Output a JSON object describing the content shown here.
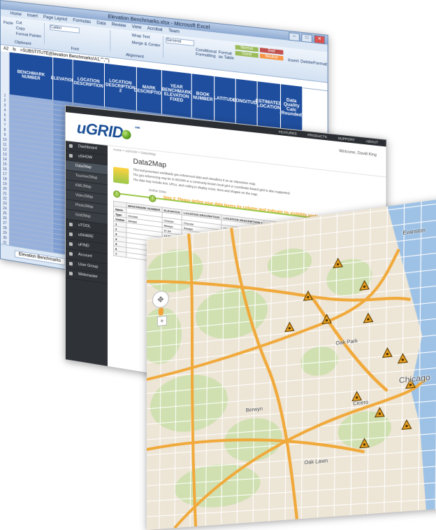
{
  "excel": {
    "window_title": "Elevation Benchmarks.xlsx - Microsoft Excel",
    "ribbon_tabs": [
      "Home",
      "Insert",
      "Page Layout",
      "Formulas",
      "Data",
      "Review",
      "View",
      "Acrobat",
      "Team"
    ],
    "ribbon_buttons": {
      "cut": "Cut",
      "copy": "Copy",
      "paste": "Paste",
      "format_painter": "Format Painter",
      "wrap_text": "Wrap Text",
      "merge_center": "Merge & Center",
      "number_format": "General",
      "conditional": "Conditional Formatting",
      "format_table": "Format as Table",
      "insert": "Insert",
      "delete": "Delete",
      "format": "Format",
      "clipboard": "Clipboard",
      "font_group": "Font",
      "alignment": "Alignment"
    },
    "font_name": "Calibri",
    "cell_ref": "A2",
    "formula": "=SUBSTITUTE(Elevation Benchmarks!A1,\"\",\"\")",
    "style_chips": [
      {
        "label": "Normal",
        "color": "#9bbb59"
      },
      {
        "label": "Bad",
        "color": "#c0504d"
      },
      {
        "label": "Good",
        "color": "#9bbb59"
      },
      {
        "label": "Neutral",
        "color": "#f79646"
      }
    ],
    "columns": [
      "BENCHMARK NUMBER",
      "ELEVATION",
      "LOCATION DESCRIPTION",
      "LOCATION DESCRIPTION 2",
      "MARK DESCRIPTION",
      "YEAR BENCHMARK ELEVATION FIXED",
      "BOOK NUMBER",
      "LATITUDE",
      "LONGITUDE",
      "ESTIMATED LOCATION",
      "Data Quality Calc (Rounded)"
    ],
    "row_numbers": [
      "1",
      "2",
      "3",
      "4",
      "5",
      "6",
      "7",
      "8",
      "9",
      "10",
      "11",
      "12",
      "13",
      "14",
      "15",
      "16",
      "17",
      "18",
      "19",
      "20",
      "21",
      "22",
      "23",
      "24",
      "25",
      "26",
      "27",
      "28",
      "29",
      "30",
      "31",
      "32",
      "33",
      "34",
      "35",
      "36",
      "37",
      "38",
      "39"
    ],
    "sheet_tab": "Elevation Benchmarks"
  },
  "app": {
    "top_links": [
      "FEATURES",
      "PRODUCTS",
      "SUPPORT",
      "ABOUT"
    ],
    "logo": "uGRID",
    "logo_tag": "Data",
    "welcome": "Welcome, David King",
    "sidebar": [
      {
        "label": "Dashboard",
        "type": "main"
      },
      {
        "label": "uSHOW",
        "type": "main"
      },
      {
        "label": "Data2Map",
        "type": "sub",
        "active": true
      },
      {
        "label": "Touchee2Map",
        "type": "sub"
      },
      {
        "label": "KML2Map",
        "type": "sub"
      },
      {
        "label": "Video2Map",
        "type": "sub"
      },
      {
        "label": "Photo2Map",
        "type": "sub"
      },
      {
        "label": "Grid2Map",
        "type": "sub"
      },
      {
        "label": "uTOOL",
        "type": "main"
      },
      {
        "label": "uSHARE",
        "type": "main"
      },
      {
        "label": "uFIND",
        "type": "main"
      },
      {
        "label": "Account",
        "type": "main"
      },
      {
        "label": "User Group",
        "type": "main"
      },
      {
        "label": "Webmaster",
        "type": "main"
      }
    ],
    "breadcrumb": "Home > uSHOW > Data2Map",
    "page_title": "Data2Map",
    "description_lines": [
      "This tool processes worldwide geo-referenced data and visualizes it on an interactive map.",
      "The geo-referencing may be in WGS84 or a commonly known local grid or coordinate-based grid is also supported.",
      "The data may include text, URLs, and coding to display icons, lines and shapes on the map."
    ],
    "stepper_label": "Define Data",
    "step2_text": "Step 2: Please define your data layers by column and indicate its visibility preference",
    "table": {
      "row_labels": [
        "Name",
        "Type",
        "Visible",
        "1",
        "2",
        "3",
        "4",
        "5",
        "6",
        "7"
      ],
      "headers": [
        "BENCHMARK NUMBER",
        "ELEVATION",
        "LOCATION DESCRIPTION",
        "LOCATION DESCRIPTION 2",
        "MARK DESCRIPTION",
        "YEAR BENCHMARK",
        "BOOK NUMBER",
        "LATITUDE",
        "LONGITUDE"
      ],
      "type_value": "Choose",
      "visible_value": "Always",
      "elevations": [
        "",
        "",
        "",
        "57.84",
        "13.88",
        "10.19",
        "13.77",
        "16.47",
        "16.95",
        "16.97"
      ]
    }
  },
  "map": {
    "labels": [
      {
        "text": "Chicago",
        "city": true
      },
      {
        "text": "Oak Park"
      },
      {
        "text": "Cicero"
      },
      {
        "text": "Evanston"
      },
      {
        "text": "Oak Lawn"
      },
      {
        "text": "Berwyn"
      }
    ],
    "marker_count": 13,
    "colors": {
      "land": "#ede5d6",
      "park": "#c8dfa8",
      "water": "#9ec2e6",
      "highway": "#f0a93a",
      "road": "#ffffff",
      "marker": "#e8a020"
    }
  }
}
